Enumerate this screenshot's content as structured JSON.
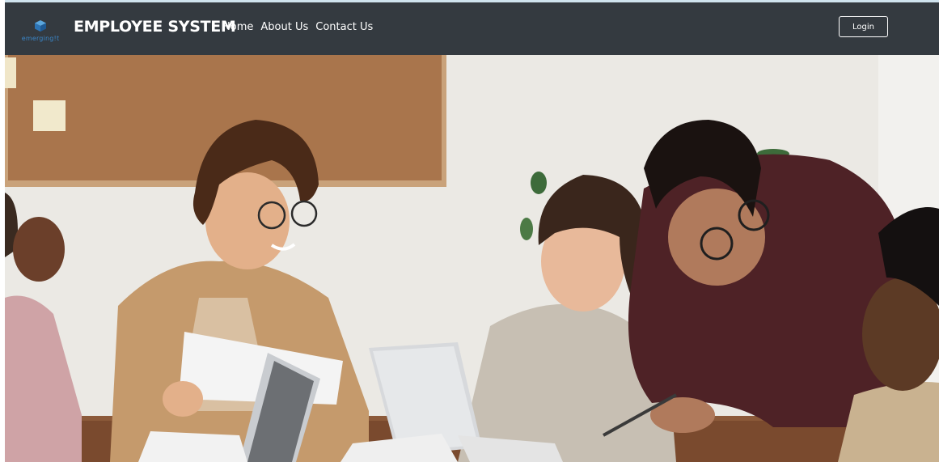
{
  "navbar": {
    "logo_text": "emerging!t",
    "brand_title": "EMPLOYEE SYSTEM",
    "links": [
      {
        "label": "Home"
      },
      {
        "label": "About Us"
      },
      {
        "label": "Contact Us"
      }
    ],
    "login_label": "Login",
    "colors": {
      "background": "#343a40",
      "text": "#ffffff",
      "logo": "#3a86c8"
    }
  },
  "hero": {
    "image": "team-meeting-photo"
  }
}
